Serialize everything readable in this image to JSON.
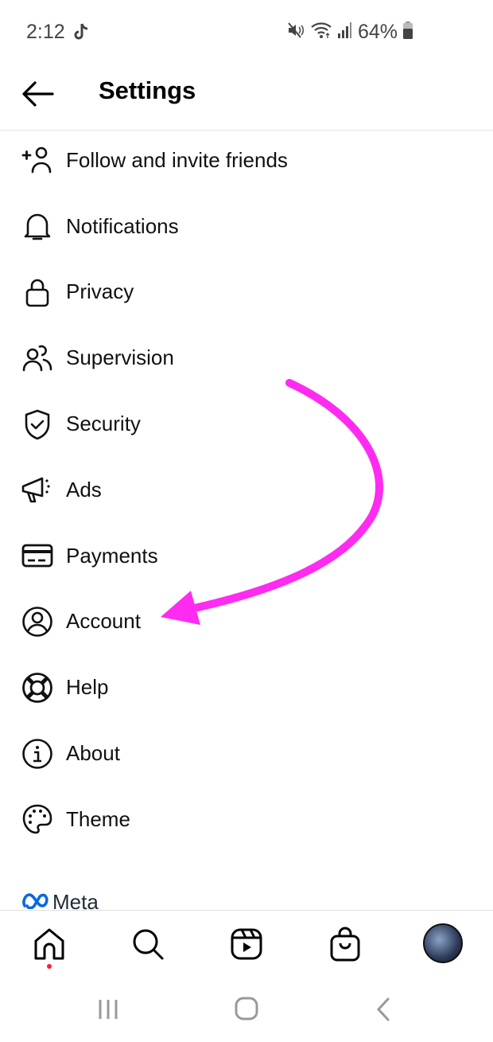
{
  "status_bar": {
    "time": "2:12",
    "battery": "64%",
    "icons": [
      "tiktok-icon",
      "mute-icon",
      "wifi-icon",
      "signal-icon",
      "battery-icon"
    ]
  },
  "header": {
    "title": "Settings",
    "back_icon": "arrow-left-icon"
  },
  "menu": {
    "items": [
      {
        "label": "Follow and invite friends",
        "icon": "add-person-icon"
      },
      {
        "label": "Notifications",
        "icon": "bell-icon"
      },
      {
        "label": "Privacy",
        "icon": "lock-icon"
      },
      {
        "label": "Supervision",
        "icon": "people-icon"
      },
      {
        "label": "Security",
        "icon": "shield-check-icon"
      },
      {
        "label": "Ads",
        "icon": "megaphone-icon"
      },
      {
        "label": "Payments",
        "icon": "card-icon"
      },
      {
        "label": "Account",
        "icon": "user-circle-icon"
      },
      {
        "label": "Help",
        "icon": "lifebuoy-icon"
      },
      {
        "label": "About",
        "icon": "info-icon"
      },
      {
        "label": "Theme",
        "icon": "palette-icon"
      }
    ]
  },
  "footer": {
    "brand": "Meta",
    "brand_color": "#0668e1"
  },
  "bottom_nav": {
    "items": [
      "home",
      "search",
      "reels",
      "shop",
      "profile"
    ],
    "notification_dot_color": "#ff1c3a"
  },
  "annotation": {
    "type": "arrow",
    "points_to": "Account",
    "color": "#ff2bf0"
  }
}
